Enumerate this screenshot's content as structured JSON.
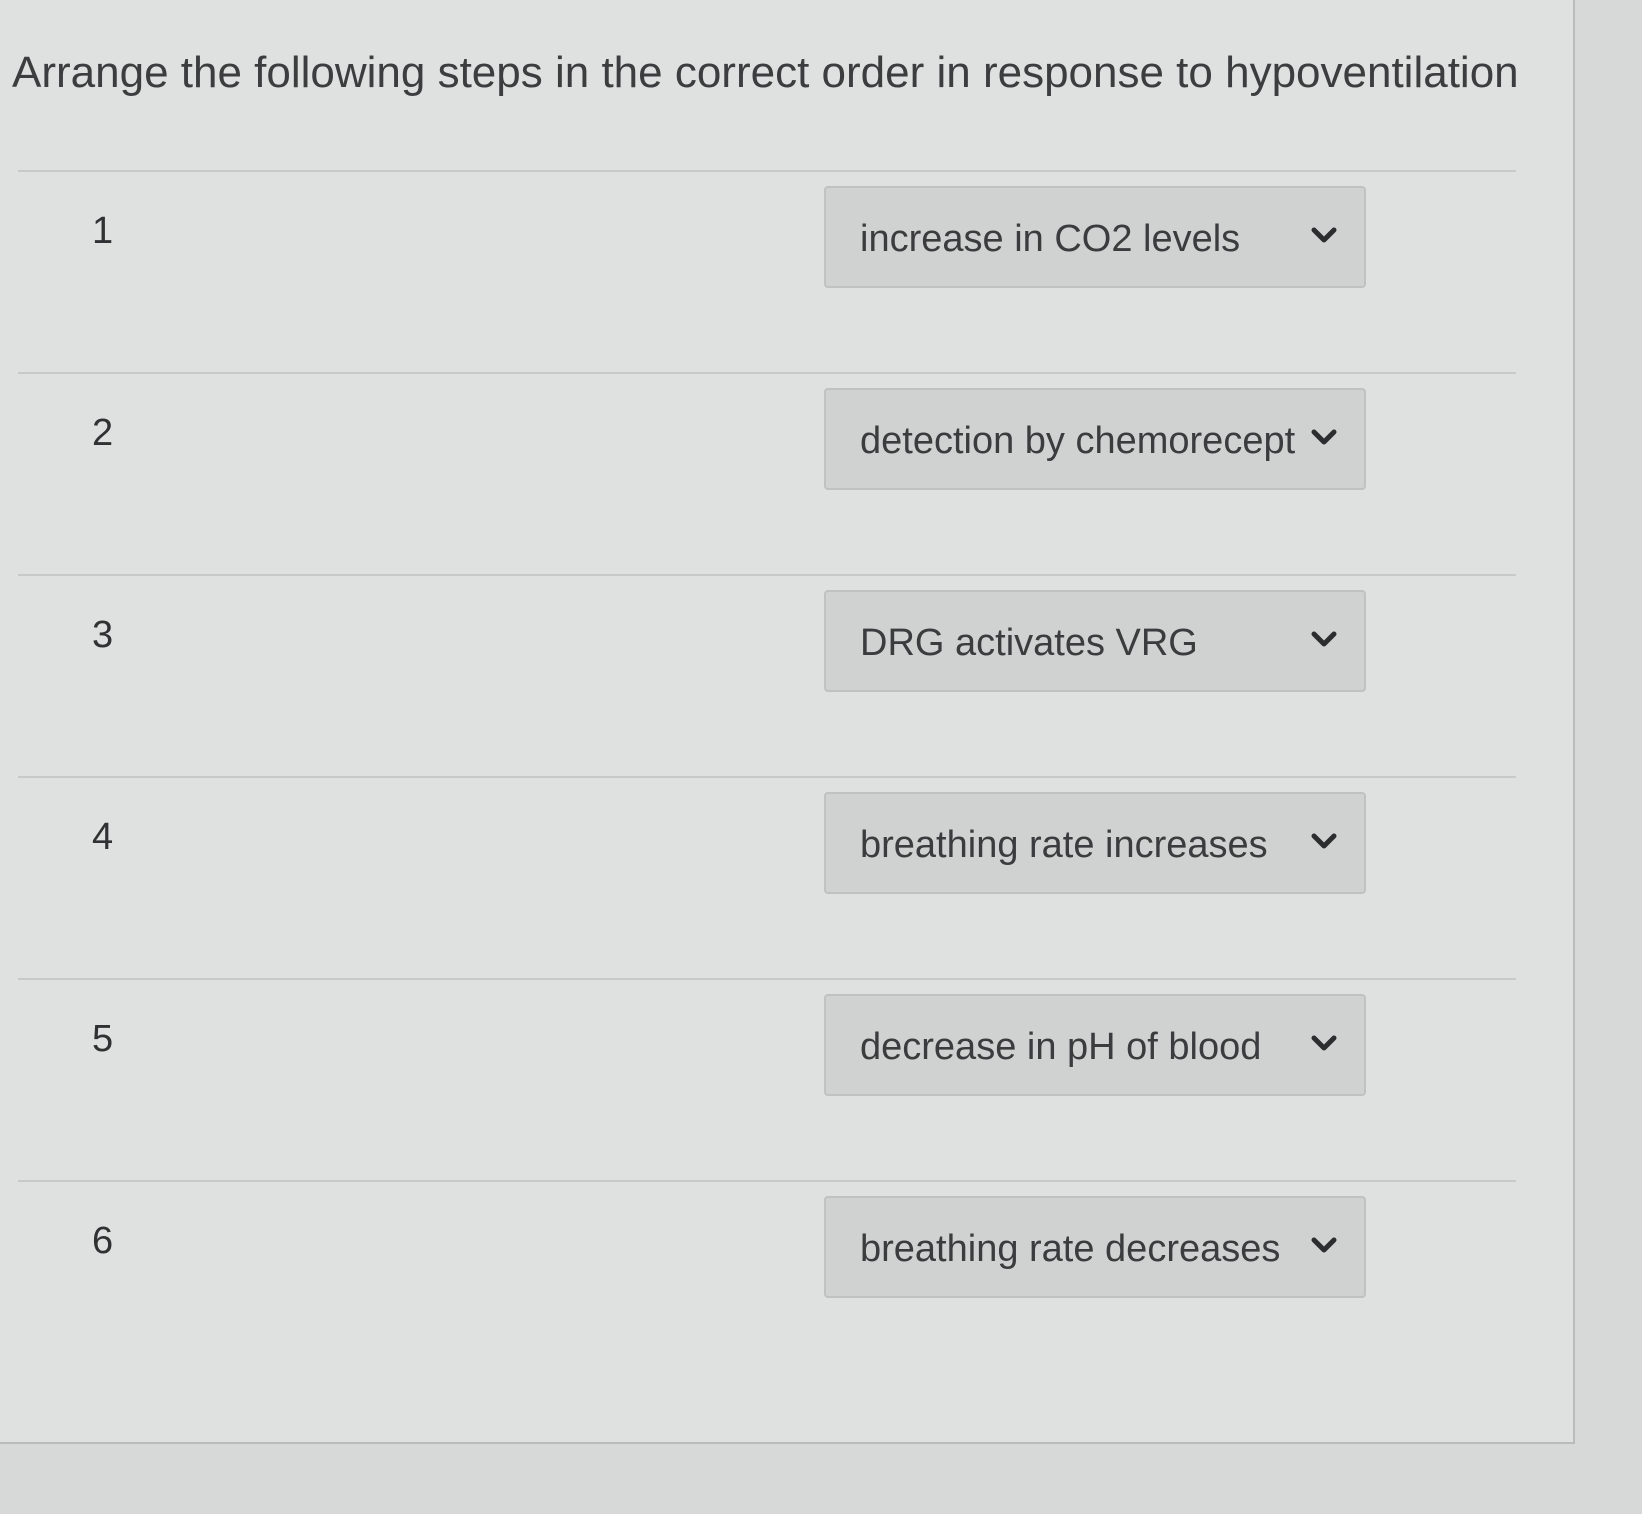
{
  "question": {
    "text": "Arrange the following steps in the correct order in response to hypoventilation"
  },
  "rows": [
    {
      "number": "1",
      "selected": "increase in CO2 levels"
    },
    {
      "number": "2",
      "selected": "detection by chemorecept"
    },
    {
      "number": "3",
      "selected": "DRG activates VRG"
    },
    {
      "number": "4",
      "selected": "breathing rate increases"
    },
    {
      "number": "5",
      "selected": "decrease in pH of blood"
    },
    {
      "number": "6",
      "selected": "breathing rate decreases"
    }
  ],
  "icons": {
    "dropdown": "chevron-down-icon"
  }
}
